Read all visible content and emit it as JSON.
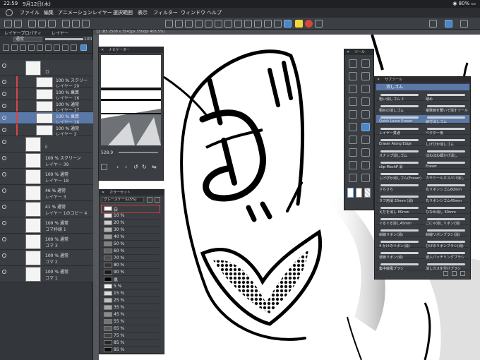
{
  "status_bar": {
    "time": "22:59",
    "date": "9月12日(木)",
    "battery": "80%"
  },
  "menu": {
    "items": [
      "ファイル",
      "編集",
      "アニメーション",
      "レイヤー",
      "選択範囲",
      "表示",
      "フィルター",
      "ウィンドウ",
      "ヘルプ"
    ]
  },
  "layer_panel": {
    "tabs": [
      "レイヤープロパティ",
      "レイヤー"
    ],
    "blend_mode": "通常",
    "opacity": "100",
    "opacity_fraction": 1.0,
    "layers": [
      {
        "mode": "",
        "name": "ロ",
        "big": true,
        "red": false,
        "selected": false
      },
      {
        "mode": "100 % スクリー",
        "name": "レイヤー 20",
        "big": false,
        "red": true,
        "selected": false
      },
      {
        "mode": "100 % 乗算",
        "name": "レイヤー 16",
        "big": false,
        "red": true,
        "selected": false
      },
      {
        "mode": "100 % 通常",
        "name": "レイヤー 17",
        "big": false,
        "red": true,
        "selected": false
      },
      {
        "mode": "100 % 乗算",
        "name": "レイヤー 18",
        "big": false,
        "red": true,
        "selected": true
      },
      {
        "mode": "100 % 通常",
        "name": "レイヤー 2",
        "big": false,
        "red": true,
        "selected": false
      },
      {
        "mode": "",
        "name": "ii",
        "big": true,
        "red": false,
        "selected": false
      },
      {
        "mode": "100 % スクリーン",
        "name": "レイヤー 39",
        "big": true,
        "red": false,
        "selected": false
      },
      {
        "mode": "100 % 通常",
        "name": "レイヤー 18",
        "big": true,
        "red": false,
        "selected": false
      },
      {
        "mode": "46 % 通常",
        "name": "レイヤー 3",
        "big": true,
        "red": false,
        "selected": false
      },
      {
        "mode": "41 % 通常",
        "name": "レイヤー 1のコピー 4",
        "big": true,
        "red": false,
        "selected": false
      },
      {
        "mode": "100 % 通常",
        "name": "コマ枠線 1",
        "big": true,
        "red": false,
        "selected": false
      },
      {
        "mode": "100 % 通常",
        "name": "コマ 3",
        "big": true,
        "red": false,
        "selected": false
      },
      {
        "mode": "100 % 通常",
        "name": "コマ 2",
        "big": true,
        "red": false,
        "selected": false
      },
      {
        "mode": "100 % 通常",
        "name": "コマ 1",
        "big": true,
        "red": false,
        "selected": false
      }
    ]
  },
  "canvas": {
    "tab_label": "12 (B5 2508 x 3541px 350dpi 403.5%)"
  },
  "navigator": {
    "title": "ナビゲーター",
    "zoom": "528.9"
  },
  "color_set": {
    "title": "カラーセット",
    "set_name": "グレースケール(5%)",
    "swatches": [
      {
        "label": "白",
        "color": "#ffffff"
      },
      {
        "label": "10 %",
        "color": "#e6e6e6"
      },
      {
        "label": "20 %",
        "color": "#cccccc"
      },
      {
        "label": "30 %",
        "color": "#b3b3b3"
      },
      {
        "label": "40 %",
        "color": "#999999"
      },
      {
        "label": "50 %",
        "color": "#808080"
      },
      {
        "label": "60 %",
        "color": "#666666"
      },
      {
        "label": "70 %",
        "color": "#4d4d4d"
      },
      {
        "label": "80 %",
        "color": "#333333"
      },
      {
        "label": "90 %",
        "color": "#1a1a1a"
      },
      {
        "label": "黒",
        "color": "#000000"
      },
      {
        "label": "5 %",
        "color": "#f2f2f2"
      },
      {
        "label": "15 %",
        "color": "#d9d9d9"
      },
      {
        "label": "25 %",
        "color": "#bfbfbf"
      },
      {
        "label": "35 %",
        "color": "#a6a6a6"
      },
      {
        "label": "45 %",
        "color": "#8c8c8c"
      },
      {
        "label": "55 %",
        "color": "#737373"
      },
      {
        "label": "65 %",
        "color": "#595959"
      },
      {
        "label": "75 %",
        "color": "#404040"
      },
      {
        "label": "85 %",
        "color": "#262626"
      },
      {
        "label": "95 %",
        "color": "#0d0d0d"
      }
    ]
  },
  "tool_panel": {
    "title": "ツール"
  },
  "subtool": {
    "title": "サブツール",
    "group": "消しゴム",
    "brushes": [
      {
        "left": "粗い消しゴム 2",
        "right": "硬め"
      },
      {
        "left": "粗めの消しゴム",
        "right": "複数線を繋いで消すツール"
      },
      {
        "left": "Quick Lasso Eraser",
        "right": "線付消しゴム"
      },
      {
        "left": "レイヤー貫通",
        "right": "ベクター用"
      },
      {
        "left": "Eraser Along Edge",
        "right": "しげぴか消しゴム"
      },
      {
        "left": "スナップ消しゴム",
        "right": "ほわほわ細かげ消し"
      },
      {
        "left": "clip-MechP 消",
        "right": "Eraser"
      },
      {
        "left": "しげぴか消しゴム(Eraser)",
        "right": "カモミールカスパパ消し"
      },
      {
        "left": "さらさら",
        "right": "丸リボンシゴム60mm"
      },
      {
        "left": "ラフ用消 20mm (消)",
        "right": "丸リボンシゴム45mm"
      },
      {
        "left": "えだを消し 60mm",
        "right": "ななめ消し 60mm"
      },
      {
        "left": "ぐるぐる消し45mm",
        "right": "ごにゃ消しリボン(消)"
      },
      {
        "left": "斜線リボン(消)",
        "right": "斜線リボンブラシ(消)"
      },
      {
        "left": "4 かけのリボン(消)",
        "right": "ひげのリボンブラシ(消)"
      },
      {
        "left": "波線リボン(消)",
        "right": "波入パッチリングブラシ"
      },
      {
        "left": "集中線風ブラシ",
        "right": "消しカスを付けブラシ"
      }
    ]
  }
}
